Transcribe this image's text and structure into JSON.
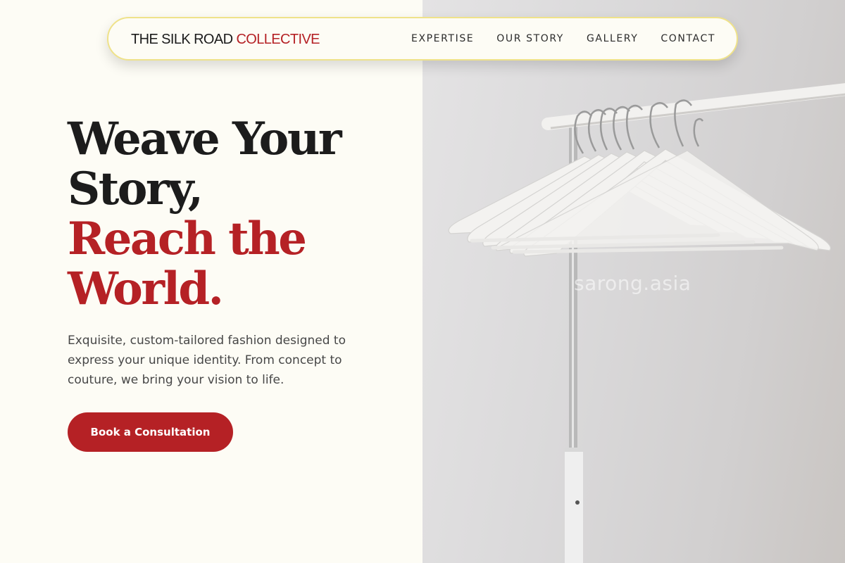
{
  "nav": {
    "brand_part1": "THE SILK ROAD",
    "brand_part2": "COLLECTIVE",
    "links": [
      "EXPERTISE",
      "OUR STORY",
      "GALLERY",
      "CONTACT"
    ]
  },
  "hero": {
    "title_line1": "Weave Your",
    "title_line2": "Story,",
    "title_line3": "Reach the",
    "title_line4": "World.",
    "description": "Exquisite, custom-tailored fashion designed to express your unique identity. From concept to couture, we bring your vision to life.",
    "cta_label": "Book a Consultation"
  },
  "image": {
    "watermark": "sarong.asia",
    "icon": "clothes-rack-with-hangers"
  },
  "colors": {
    "accent": "#b52125",
    "background": "#fdfcf5",
    "nav_border": "#efe28a",
    "text_dark": "#1c1c1c"
  }
}
